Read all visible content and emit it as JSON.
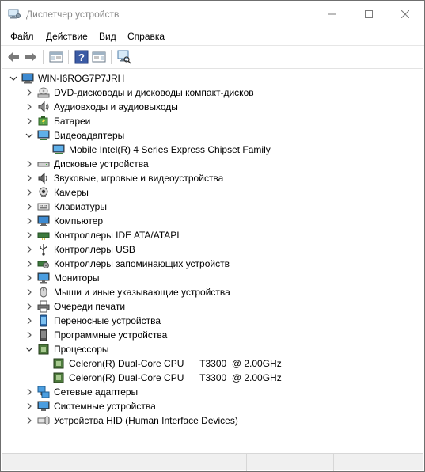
{
  "window": {
    "title": "Диспетчер устройств"
  },
  "menu": {
    "items": [
      "Файл",
      "Действие",
      "Вид",
      "Справка"
    ]
  },
  "tree": {
    "root": "WIN-I6ROG7P7JRH",
    "categories": [
      {
        "label": "DVD-дисководы и дисководы компакт-дисков",
        "icon": "dvd-drive-icon",
        "expanded": false
      },
      {
        "label": "Аудиовходы и аудиовыходы",
        "icon": "audio-io-icon",
        "expanded": false
      },
      {
        "label": "Батареи",
        "icon": "battery-icon",
        "expanded": false
      },
      {
        "label": "Видеоадаптеры",
        "icon": "display-adapter-icon",
        "expanded": true
      },
      {
        "label": "Дисковые устройства",
        "icon": "disk-drive-icon",
        "expanded": false
      },
      {
        "label": "Звуковые, игровые и видеоустройства",
        "icon": "sound-icon",
        "expanded": false
      },
      {
        "label": "Камеры",
        "icon": "camera-icon",
        "expanded": false
      },
      {
        "label": "Клавиатуры",
        "icon": "keyboard-icon",
        "expanded": false
      },
      {
        "label": "Компьютер",
        "icon": "computer-icon",
        "expanded": false
      },
      {
        "label": "Контроллеры IDE ATA/ATAPI",
        "icon": "ide-controller-icon",
        "expanded": false
      },
      {
        "label": "Контроллеры USB",
        "icon": "usb-icon",
        "expanded": false
      },
      {
        "label": "Контроллеры запоминающих устройств",
        "icon": "storage-controller-icon",
        "expanded": false
      },
      {
        "label": "Мониторы",
        "icon": "monitor-icon",
        "expanded": false
      },
      {
        "label": "Мыши и иные указывающие устройства",
        "icon": "mouse-icon",
        "expanded": false
      },
      {
        "label": "Очереди печати",
        "icon": "printer-icon",
        "expanded": false
      },
      {
        "label": "Переносные устройства",
        "icon": "portable-device-icon",
        "expanded": false
      },
      {
        "label": "Программные устройства",
        "icon": "software-device-icon",
        "expanded": false
      },
      {
        "label": "Процессоры",
        "icon": "processor-icon",
        "expanded": true
      },
      {
        "label": "Сетевые адаптеры",
        "icon": "network-adapter-icon",
        "expanded": false
      },
      {
        "label": "Системные устройства",
        "icon": "system-device-icon",
        "expanded": false
      },
      {
        "label": "Устройства HID (Human Interface Devices)",
        "icon": "hid-icon",
        "expanded": false
      }
    ],
    "video_adapters": [
      "Mobile Intel(R) 4 Series Express Chipset Family"
    ],
    "processors": [
      "Celeron(R) Dual-Core CPU      T3300  @ 2.00GHz",
      "Celeron(R) Dual-Core CPU      T3300  @ 2.00GHz"
    ]
  }
}
